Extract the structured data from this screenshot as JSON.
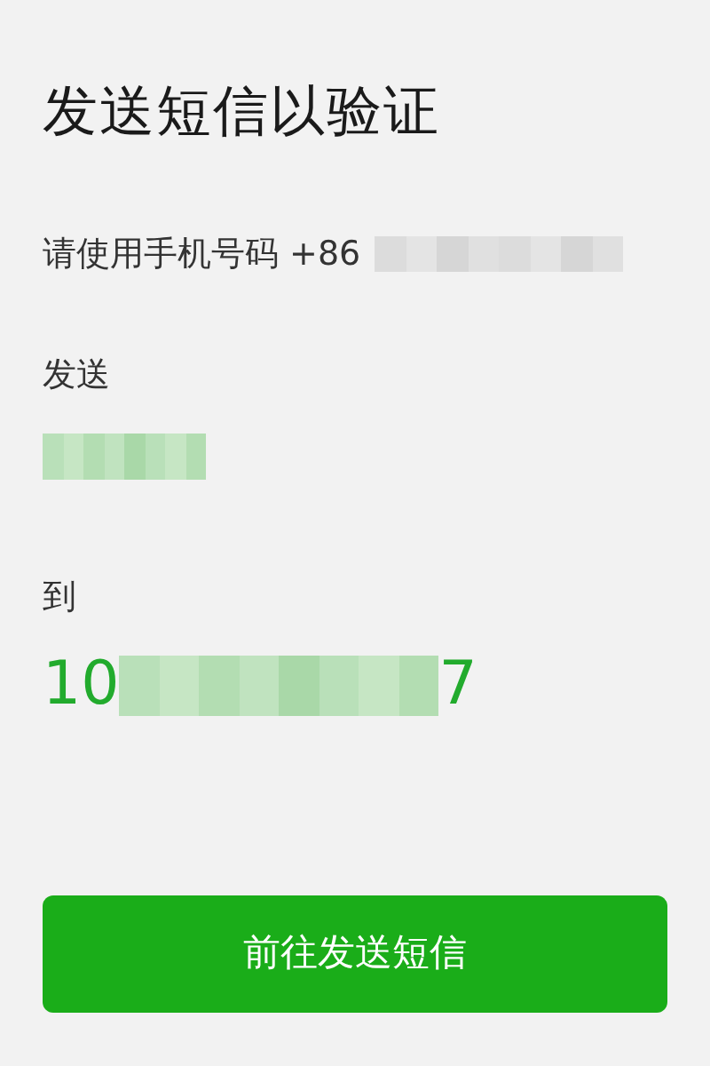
{
  "title": "发送短信以验证",
  "instruction": {
    "text": "请使用手机号码 +86",
    "redacted": true
  },
  "send": {
    "label": "发送",
    "redacted": true
  },
  "to": {
    "label": "到",
    "prefix": "10",
    "suffix": "7",
    "redacted": true
  },
  "button": {
    "label": "前往发送短信"
  }
}
